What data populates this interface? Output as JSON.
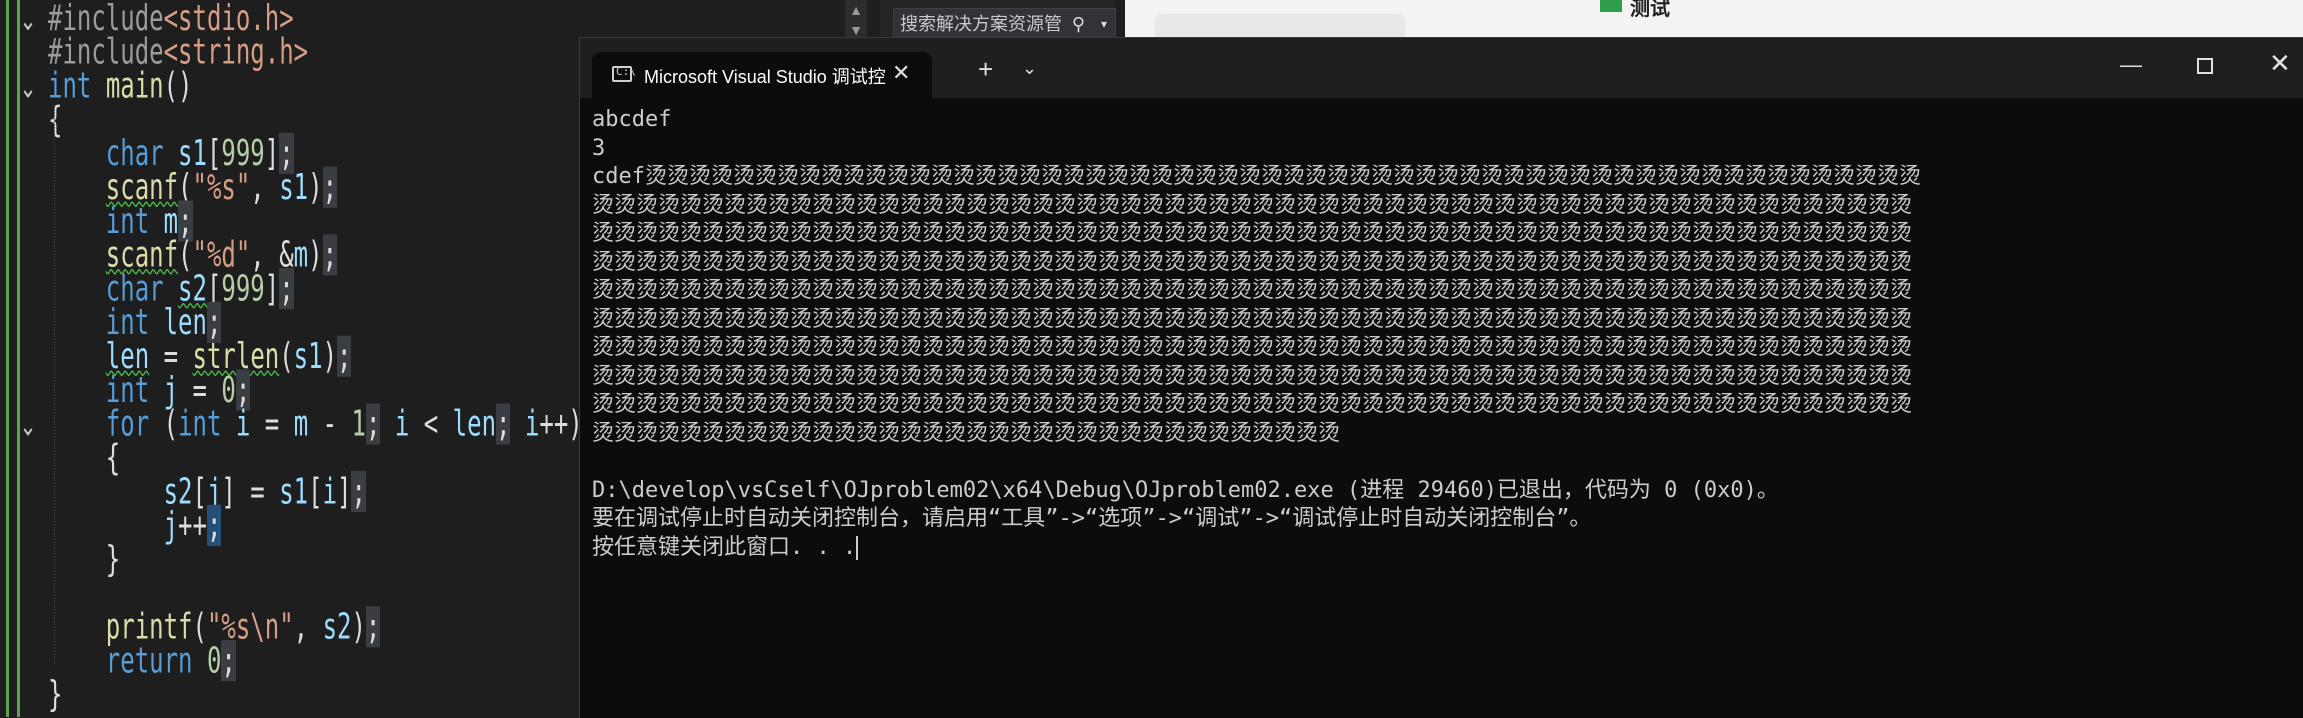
{
  "editor": {
    "lines": [
      {
        "fold": "v",
        "tokens": [
          {
            "c": "pp",
            "t": "#include"
          },
          {
            "c": "inc",
            "t": "<stdio.h>"
          }
        ]
      },
      {
        "fold": "",
        "tokens": [
          {
            "c": "pp",
            "t": "#include"
          },
          {
            "c": "inc",
            "t": "<string.h>"
          }
        ]
      },
      {
        "fold": "v",
        "tokens": [
          {
            "c": "kw",
            "t": "int"
          },
          {
            "c": "punct",
            "t": " "
          },
          {
            "c": "fn",
            "t": "main"
          },
          {
            "c": "punct",
            "t": "()"
          }
        ]
      },
      {
        "fold": "",
        "tokens": [
          {
            "c": "punct",
            "t": "{"
          }
        ]
      },
      {
        "fold": "",
        "tokens": [
          {
            "c": "punct",
            "t": "    "
          },
          {
            "c": "kw",
            "t": "char"
          },
          {
            "c": "punct",
            "t": " "
          },
          {
            "c": "var",
            "t": "s1"
          },
          {
            "c": "punct",
            "t": "["
          },
          {
            "c": "num",
            "t": "999"
          },
          {
            "c": "punct",
            "t": "]"
          },
          {
            "c": "semi",
            "t": ";"
          }
        ]
      },
      {
        "fold": "",
        "tokens": [
          {
            "c": "punct",
            "t": "    "
          },
          {
            "c": "fnsq",
            "t": "scanf"
          },
          {
            "c": "punct",
            "t": "("
          },
          {
            "c": "str",
            "t": "\"%s\""
          },
          {
            "c": "punct",
            "t": ", "
          },
          {
            "c": "var",
            "t": "s1"
          },
          {
            "c": "punct",
            "t": ")"
          },
          {
            "c": "semi",
            "t": ";"
          }
        ]
      },
      {
        "fold": "",
        "tokens": [
          {
            "c": "punct",
            "t": "    "
          },
          {
            "c": "kw",
            "t": "int"
          },
          {
            "c": "punct",
            "t": " "
          },
          {
            "c": "var",
            "t": "m"
          },
          {
            "c": "semi",
            "t": ";"
          }
        ]
      },
      {
        "fold": "",
        "tokens": [
          {
            "c": "punct",
            "t": "    "
          },
          {
            "c": "fnsq",
            "t": "scanf"
          },
          {
            "c": "punct",
            "t": "("
          },
          {
            "c": "str",
            "t": "\"%d\""
          },
          {
            "c": "punct",
            "t": ", &"
          },
          {
            "c": "var",
            "t": "m"
          },
          {
            "c": "punct",
            "t": ")"
          },
          {
            "c": "semi",
            "t": ";"
          }
        ]
      },
      {
        "fold": "",
        "tokens": [
          {
            "c": "punct",
            "t": "    "
          },
          {
            "c": "kw",
            "t": "char"
          },
          {
            "c": "punct",
            "t": " "
          },
          {
            "c": "varsq",
            "t": "s2"
          },
          {
            "c": "punct",
            "t": "["
          },
          {
            "c": "num",
            "t": "999"
          },
          {
            "c": "punct",
            "t": "]"
          },
          {
            "c": "semi",
            "t": ";"
          }
        ]
      },
      {
        "fold": "",
        "tokens": [
          {
            "c": "punct",
            "t": "    "
          },
          {
            "c": "kw",
            "t": "int"
          },
          {
            "c": "punct",
            "t": " "
          },
          {
            "c": "var",
            "t": "len"
          },
          {
            "c": "semi",
            "t": ";"
          }
        ]
      },
      {
        "fold": "",
        "tokens": [
          {
            "c": "punct",
            "t": "    "
          },
          {
            "c": "varsq",
            "t": "len"
          },
          {
            "c": "punct",
            "t": " = "
          },
          {
            "c": "fnsq",
            "t": "strlen"
          },
          {
            "c": "punct",
            "t": "("
          },
          {
            "c": "var",
            "t": "s1"
          },
          {
            "c": "punct",
            "t": ")"
          },
          {
            "c": "semi",
            "t": ";"
          }
        ]
      },
      {
        "fold": "",
        "tokens": [
          {
            "c": "punct",
            "t": "    "
          },
          {
            "c": "kw",
            "t": "int"
          },
          {
            "c": "punct",
            "t": " "
          },
          {
            "c": "var",
            "t": "j"
          },
          {
            "c": "punct",
            "t": " = "
          },
          {
            "c": "num",
            "t": "0"
          },
          {
            "c": "semi",
            "t": ";"
          }
        ]
      },
      {
        "fold": "v",
        "tokens": [
          {
            "c": "punct",
            "t": "    "
          },
          {
            "c": "kw",
            "t": "for"
          },
          {
            "c": "punct",
            "t": " ("
          },
          {
            "c": "kw",
            "t": "int"
          },
          {
            "c": "punct",
            "t": " "
          },
          {
            "c": "var",
            "t": "i"
          },
          {
            "c": "punct",
            "t": " = "
          },
          {
            "c": "var",
            "t": "m"
          },
          {
            "c": "punct",
            "t": " - "
          },
          {
            "c": "num",
            "t": "1"
          },
          {
            "c": "semi",
            "t": ";"
          },
          {
            "c": "punct",
            "t": " "
          },
          {
            "c": "var",
            "t": "i"
          },
          {
            "c": "punct",
            "t": " < "
          },
          {
            "c": "var",
            "t": "len"
          },
          {
            "c": "semi",
            "t": ";"
          },
          {
            "c": "punct",
            "t": " "
          },
          {
            "c": "var",
            "t": "i"
          },
          {
            "c": "punct",
            "t": "++)"
          }
        ]
      },
      {
        "fold": "",
        "tokens": [
          {
            "c": "punct",
            "t": "    {"
          }
        ]
      },
      {
        "fold": "",
        "tokens": [
          {
            "c": "punct",
            "t": "        "
          },
          {
            "c": "var",
            "t": "s2"
          },
          {
            "c": "punct",
            "t": "["
          },
          {
            "c": "var",
            "t": "j"
          },
          {
            "c": "punct",
            "t": "] = "
          },
          {
            "c": "var",
            "t": "s1"
          },
          {
            "c": "punct",
            "t": "["
          },
          {
            "c": "var",
            "t": "i"
          },
          {
            "c": "punct",
            "t": "]"
          },
          {
            "c": "semi",
            "t": ";"
          }
        ]
      },
      {
        "fold": "",
        "tokens": [
          {
            "c": "punct",
            "t": "        "
          },
          {
            "c": "var",
            "t": "j"
          },
          {
            "c": "punct",
            "t": "++"
          },
          {
            "c": "semisel",
            "t": ";"
          }
        ]
      },
      {
        "fold": "",
        "tokens": [
          {
            "c": "punct",
            "t": "    }"
          }
        ]
      },
      {
        "fold": "",
        "tokens": [
          {
            "c": "punct",
            "t": ""
          }
        ]
      },
      {
        "fold": "",
        "tokens": [
          {
            "c": "punct",
            "t": "    "
          },
          {
            "c": "fn",
            "t": "printf"
          },
          {
            "c": "punct",
            "t": "("
          },
          {
            "c": "str",
            "t": "\"%s\\n\""
          },
          {
            "c": "punct",
            "t": ", "
          },
          {
            "c": "var",
            "t": "s2"
          },
          {
            "c": "punct",
            "t": ")"
          },
          {
            "c": "semi",
            "t": ";"
          }
        ]
      },
      {
        "fold": "",
        "tokens": [
          {
            "c": "punct",
            "t": "    "
          },
          {
            "c": "kw",
            "t": "return"
          },
          {
            "c": "punct",
            "t": " "
          },
          {
            "c": "num",
            "t": "0"
          },
          {
            "c": "semi",
            "t": ";"
          }
        ]
      },
      {
        "fold": "",
        "tokens": [
          {
            "c": "punct",
            "t": "}"
          }
        ]
      }
    ]
  },
  "search": {
    "placeholder": "搜索解决方案资源管"
  },
  "right_pane": {
    "label": "测试"
  },
  "terminal": {
    "tab_title": "Microsoft Visual Studio 调试控",
    "tab_icon_glyph": "C:\\",
    "close_glyph": "✕",
    "new_tab_glyph": "+",
    "dropdown_glyph": "⌄",
    "minimize_glyph": "—",
    "window_close_glyph": "✕",
    "output": [
      "abcdef",
      "3",
      "cdef烫烫烫烫烫烫烫烫烫烫烫烫烫烫烫烫烫烫烫烫烫烫烫烫烫烫烫烫烫烫烫烫烫烫烫烫烫烫烫烫烫烫烫烫烫烫烫烫烫烫烫烫烫烫烫烫烫烫",
      "烫烫烫烫烫烫烫烫烫烫烫烫烫烫烫烫烫烫烫烫烫烫烫烫烫烫烫烫烫烫烫烫烫烫烫烫烫烫烫烫烫烫烫烫烫烫烫烫烫烫烫烫烫烫烫烫烫烫烫烫",
      "烫烫烫烫烫烫烫烫烫烫烫烫烫烫烫烫烫烫烫烫烫烫烫烫烫烫烫烫烫烫烫烫烫烫烫烫烫烫烫烫烫烫烫烫烫烫烫烫烫烫烫烫烫烫烫烫烫烫烫烫",
      "烫烫烫烫烫烫烫烫烫烫烫烫烫烫烫烫烫烫烫烫烫烫烫烫烫烫烫烫烫烫烫烫烫烫烫烫烫烫烫烫烫烫烫烫烫烫烫烫烫烫烫烫烫烫烫烫烫烫烫烫",
      "烫烫烫烫烫烫烫烫烫烫烫烫烫烫烫烫烫烫烫烫烫烫烫烫烫烫烫烫烫烫烫烫烫烫烫烫烫烫烫烫烫烫烫烫烫烫烫烫烫烫烫烫烫烫烫烫烫烫烫烫",
      "烫烫烫烫烫烫烫烫烫烫烫烫烫烫烫烫烫烫烫烫烫烫烫烫烫烫烫烫烫烫烫烫烫烫烫烫烫烫烫烫烫烫烫烫烫烫烫烫烫烫烫烫烫烫烫烫烫烫烫烫",
      "烫烫烫烫烫烫烫烫烫烫烫烫烫烫烫烫烫烫烫烫烫烫烫烫烫烫烫烫烫烫烫烫烫烫烫烫烫烫烫烫烫烫烫烫烫烫烫烫烫烫烫烫烫烫烫烫烫烫烫烫",
      "烫烫烫烫烫烫烫烫烫烫烫烫烫烫烫烫烫烫烫烫烫烫烫烫烫烫烫烫烫烫烫烫烫烫烫烫烫烫烫烫烫烫烫烫烫烫烫烫烫烫烫烫烫烫烫烫烫烫烫烫",
      "烫烫烫烫烫烫烫烫烫烫烫烫烫烫烫烫烫烫烫烫烫烫烫烫烫烫烫烫烫烫烫烫烫烫烫烫烫烫烫烫烫烫烫烫烫烫烫烫烫烫烫烫烫烫烫烫烫烫烫烫",
      "烫烫烫烫烫烫烫烫烫烫烫烫烫烫烫烫烫烫烫烫烫烫烫烫烫烫烫烫烫烫烫烫烫烫",
      "",
      "D:\\develop\\vsCself\\OJproblem02\\x64\\Debug\\OJproblem02.exe (进程 29460)已退出，代码为 0 (0x0)。",
      "要在调试停止时自动关闭控制台，请启用“工具”->“选项”->“调试”->“调试停止时自动关闭控制台”。",
      "按任意键关闭此窗口. . ."
    ]
  }
}
